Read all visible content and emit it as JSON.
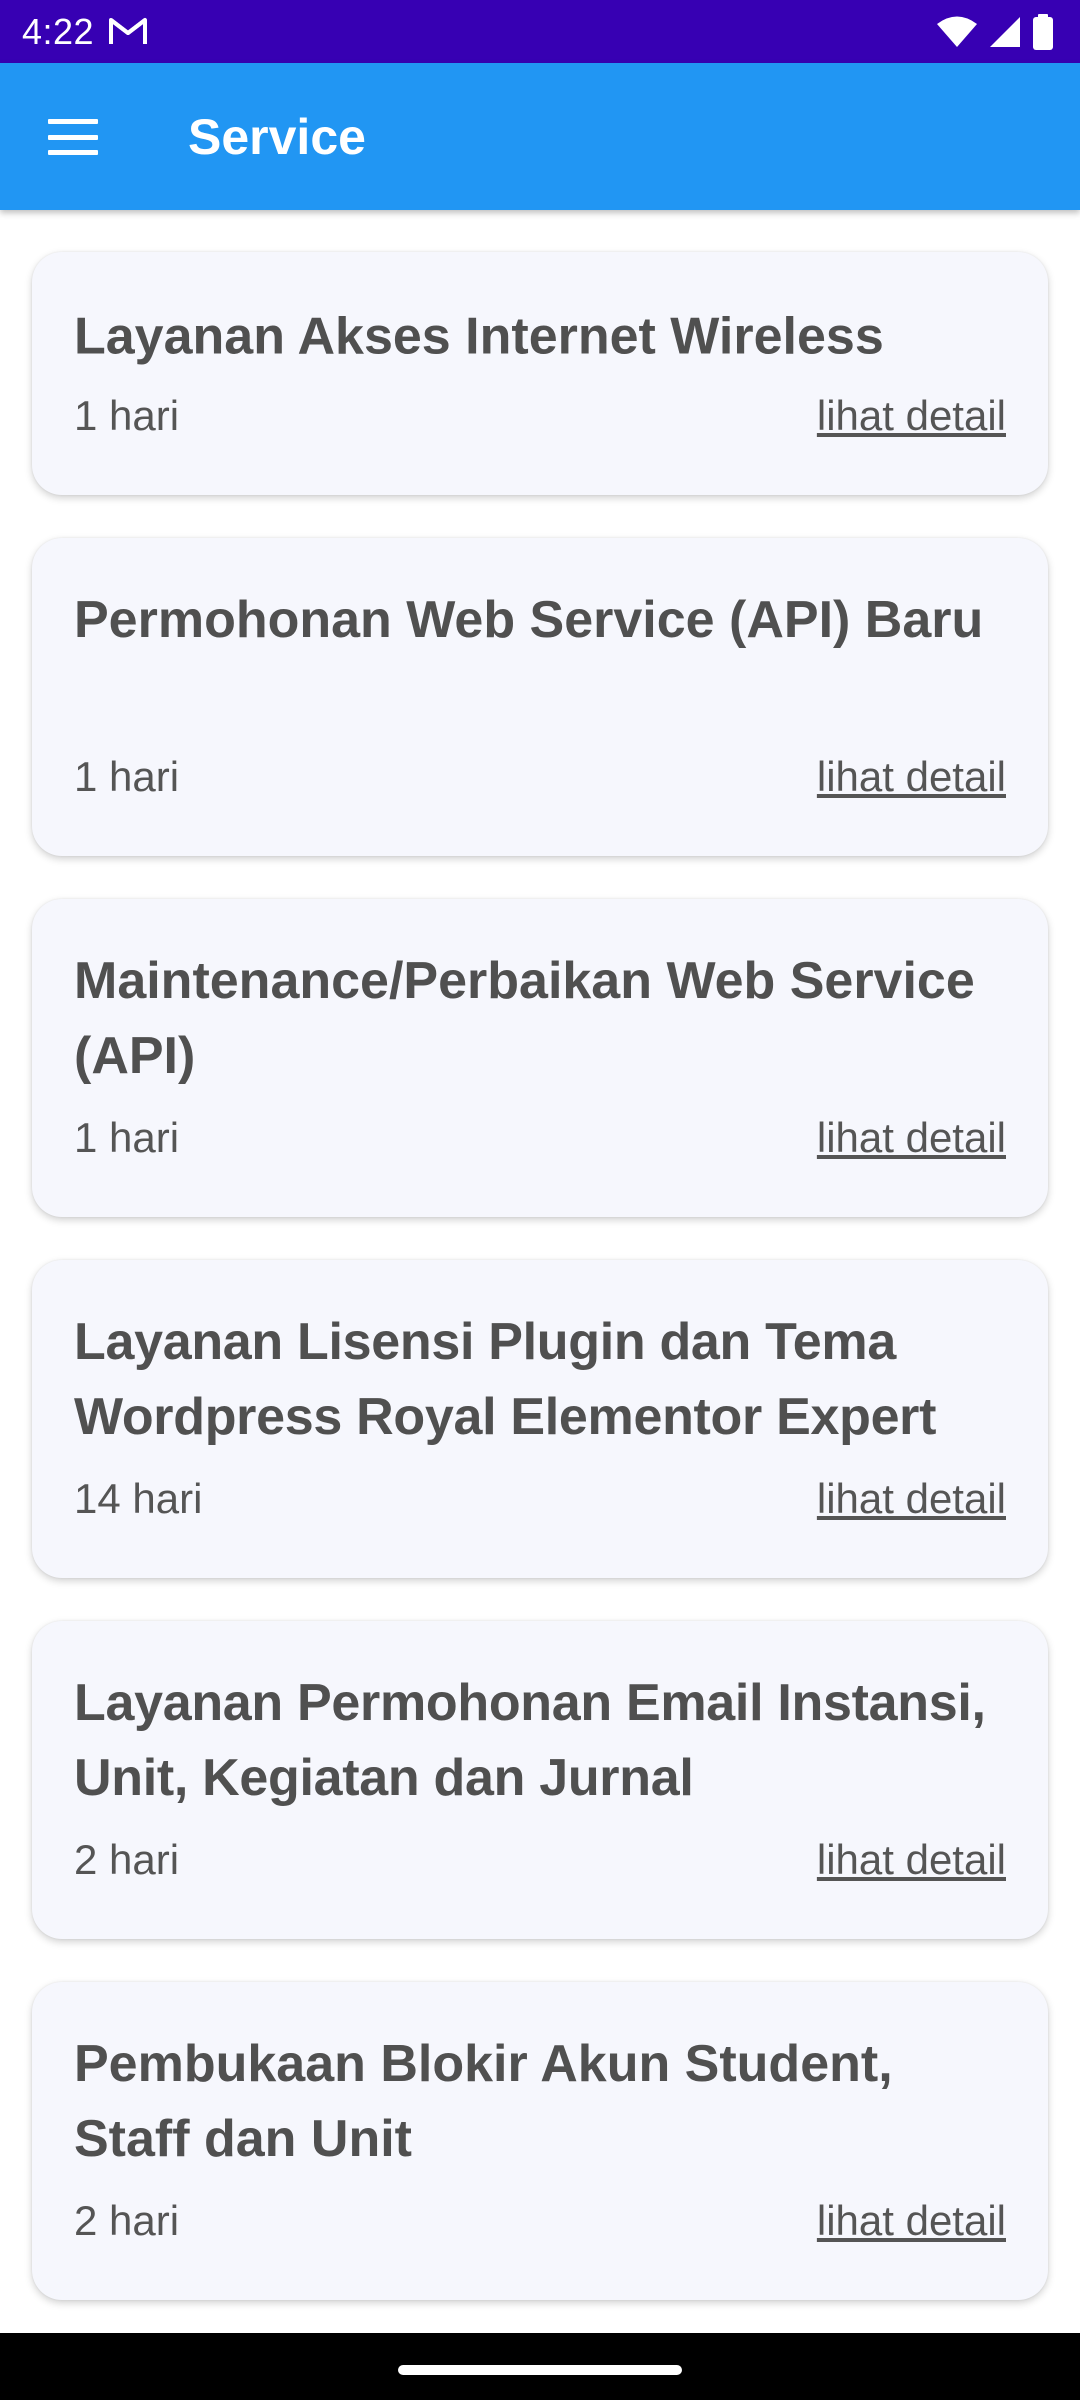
{
  "status_bar": {
    "time": "4:22",
    "icons": [
      "gmail-icon",
      "wifi-icon",
      "signal-icon",
      "battery-icon"
    ],
    "background": "#3700B3"
  },
  "app_bar": {
    "title": "Service",
    "menu_icon": "hamburger-menu-icon",
    "background": "#2196F3"
  },
  "services": [
    {
      "title": "Layanan Akses Internet Wireless",
      "duration": "1 hari",
      "link": "lihat detail"
    },
    {
      "title": "Permohonan Web Service (API) Baru",
      "duration": "1 hari",
      "link": "lihat detail"
    },
    {
      "title": "Maintenance/Perbaikan Web Service (API)",
      "duration": "1 hari",
      "link": "lihat detail"
    },
    {
      "title": "Layanan Lisensi Plugin dan Tema Wordpress Royal Elementor Expert",
      "duration": "14 hari",
      "link": "lihat detail"
    },
    {
      "title": "Layanan Permohonan Email Instansi, Unit, Kegiatan dan Jurnal",
      "duration": "2 hari",
      "link": "lihat detail"
    },
    {
      "title": "Pembukaan Blokir Akun Student, Staff dan Unit",
      "duration": "2 hari",
      "link": "lihat detail"
    }
  ],
  "colors": {
    "card_background": "#F6F7FD",
    "text": "#505050"
  }
}
